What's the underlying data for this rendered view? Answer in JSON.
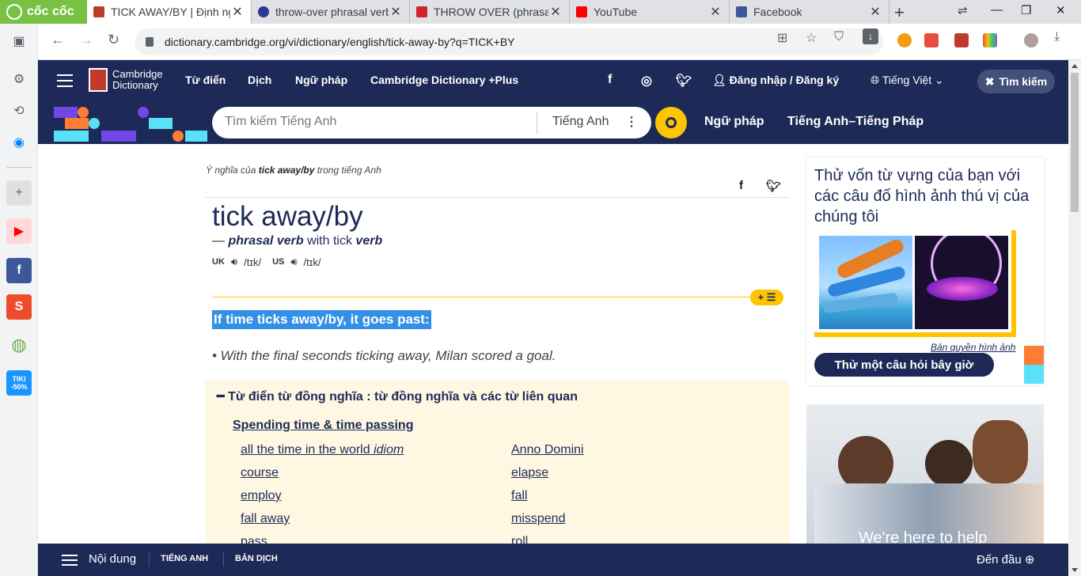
{
  "browser": {
    "brand": "cốc cốc",
    "tabs": [
      {
        "title": "TICK AWAY/BY | Định ng",
        "active": true
      },
      {
        "title": "throw-over phrasal verb"
      },
      {
        "title": "THROW OVER (phrasal v"
      },
      {
        "title": "YouTube"
      },
      {
        "title": "Facebook"
      }
    ],
    "url": "dictionary.cambridge.org/vi/dictionary/english/tick-away-by?q=TICK+BY"
  },
  "header": {
    "logo_line1": "Cambridge",
    "logo_line2": "Dictionary",
    "nav": [
      "Từ điển",
      "Dịch",
      "Ngữ pháp",
      "Cambridge Dictionary +Plus"
    ],
    "login": "Đăng nhập / Đăng ký",
    "language": "Tiếng Việt",
    "search_close": "Tìm kiếm"
  },
  "search": {
    "placeholder": "Tìm kiếm Tiếng Anh",
    "language": "Tiếng Anh",
    "links": [
      "Ngữ pháp",
      "Tiếng Anh–Tiếng Pháp"
    ]
  },
  "entry": {
    "meaning_prefix": "Ý nghĩa của",
    "meaning_word": "tick away/by",
    "meaning_suffix": "trong tiếng Anh",
    "headword": "tick away/by",
    "pos_dash": "—",
    "pos_type": "phrasal verb",
    "pos_with": "with tick",
    "pos_verb": "verb",
    "uk_label": "UK",
    "uk_ipa": "/tɪk/",
    "us_label": "US",
    "us_ipa": "/tɪk/",
    "plus_label": "+ ☰",
    "definition": "If time ticks away/by, it goes past:",
    "example": "• With the final seconds ticking away, Milan scored a goal."
  },
  "synonyms": {
    "title": "Từ điển từ đồng nghĩa : từ đồng nghĩa và các từ liên quan",
    "category": "Spending time & time passing",
    "left": [
      {
        "word": "all the time in the world",
        "tag": "idiom"
      },
      {
        "word": "course"
      },
      {
        "word": "employ"
      },
      {
        "word": "fall away"
      },
      {
        "word": "pass"
      }
    ],
    "right": [
      "Anno Domini",
      "elapse",
      "fall",
      "misspend",
      "roll"
    ]
  },
  "quiz": {
    "title": "Thử vốn từ vựng của bạn với các câu đố hình ảnh thú vị của chúng tôi",
    "copyright": "Bản quyền hình ảnh",
    "button": "Thử một câu hỏi bây giờ"
  },
  "promo": {
    "text": "We're here to help"
  },
  "footer": {
    "contents": "Nội dung",
    "links": [
      "TIẾNG ANH",
      "BẢN DỊCH"
    ],
    "top": "Đến đầu"
  },
  "sidebar_icons": [
    "panel-icon",
    "settings-icon",
    "history-icon",
    "messenger-icon",
    "add-icon",
    "youtube-icon",
    "facebook-icon",
    "shopee-icon",
    "extension-icon",
    "tiki-icon"
  ],
  "sidebar_tiki": "TIKI -50%",
  "colors": {
    "navy": "#1d2a57",
    "yellow": "#fec400",
    "highlight": "#3390e6",
    "synbg": "#fef7e2"
  }
}
